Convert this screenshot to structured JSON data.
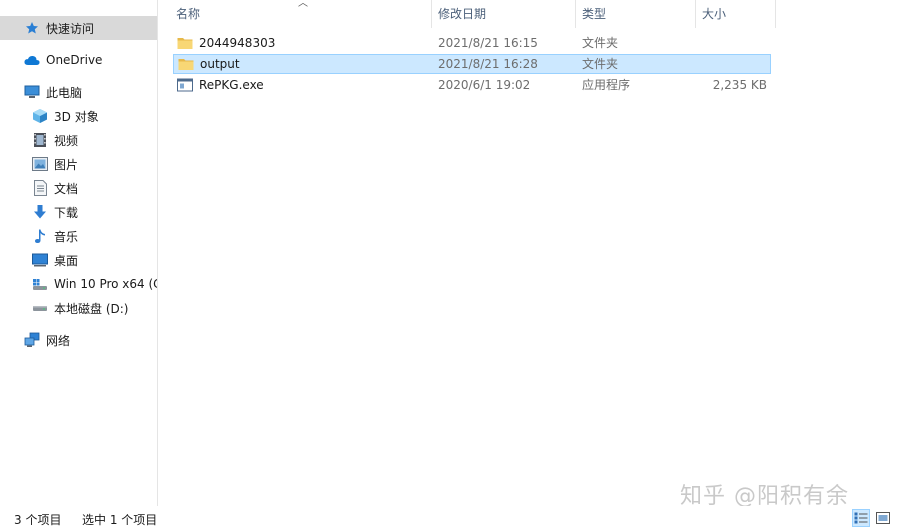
{
  "sidebar": {
    "quick_access": "快速访问",
    "onedrive": "OneDrive",
    "this_pc": "此电脑",
    "items": [
      {
        "label": "3D 对象",
        "icon": "3d-objects-icon"
      },
      {
        "label": "视频",
        "icon": "video-icon"
      },
      {
        "label": "图片",
        "icon": "pictures-icon"
      },
      {
        "label": "文档",
        "icon": "documents-icon"
      },
      {
        "label": "下载",
        "icon": "download-icon"
      },
      {
        "label": "音乐",
        "icon": "music-icon"
      },
      {
        "label": "桌面",
        "icon": "desktop-icon"
      },
      {
        "label": "Win 10 Pro x64 (C",
        "icon": "system-drive-icon"
      },
      {
        "label": "本地磁盘 (D:)",
        "icon": "local-disk-icon"
      }
    ],
    "network": "网络"
  },
  "columns": {
    "name": "名称",
    "date": "修改日期",
    "type": "类型",
    "size": "大小"
  },
  "files": [
    {
      "name": "2044948303",
      "date": "2021/8/21 16:15",
      "type": "文件夹",
      "size": "",
      "icon": "folder-icon",
      "selected": false
    },
    {
      "name": "output",
      "date": "2021/8/21 16:28",
      "type": "文件夹",
      "size": "",
      "icon": "folder-icon",
      "selected": true
    },
    {
      "name": "RePKG.exe",
      "date": "2020/6/1 19:02",
      "type": "应用程序",
      "size": "2,235 KB",
      "icon": "exe-icon",
      "selected": false
    }
  ],
  "status": {
    "item_count": "3 个项目",
    "selected_count": "选中 1 个项目"
  },
  "watermark": "知乎 @阳积有余",
  "colors": {
    "selection_bg": "#cce8ff",
    "selection_border": "#99d1ff",
    "folder": "#f8d775",
    "header_text": "#4c607a"
  }
}
